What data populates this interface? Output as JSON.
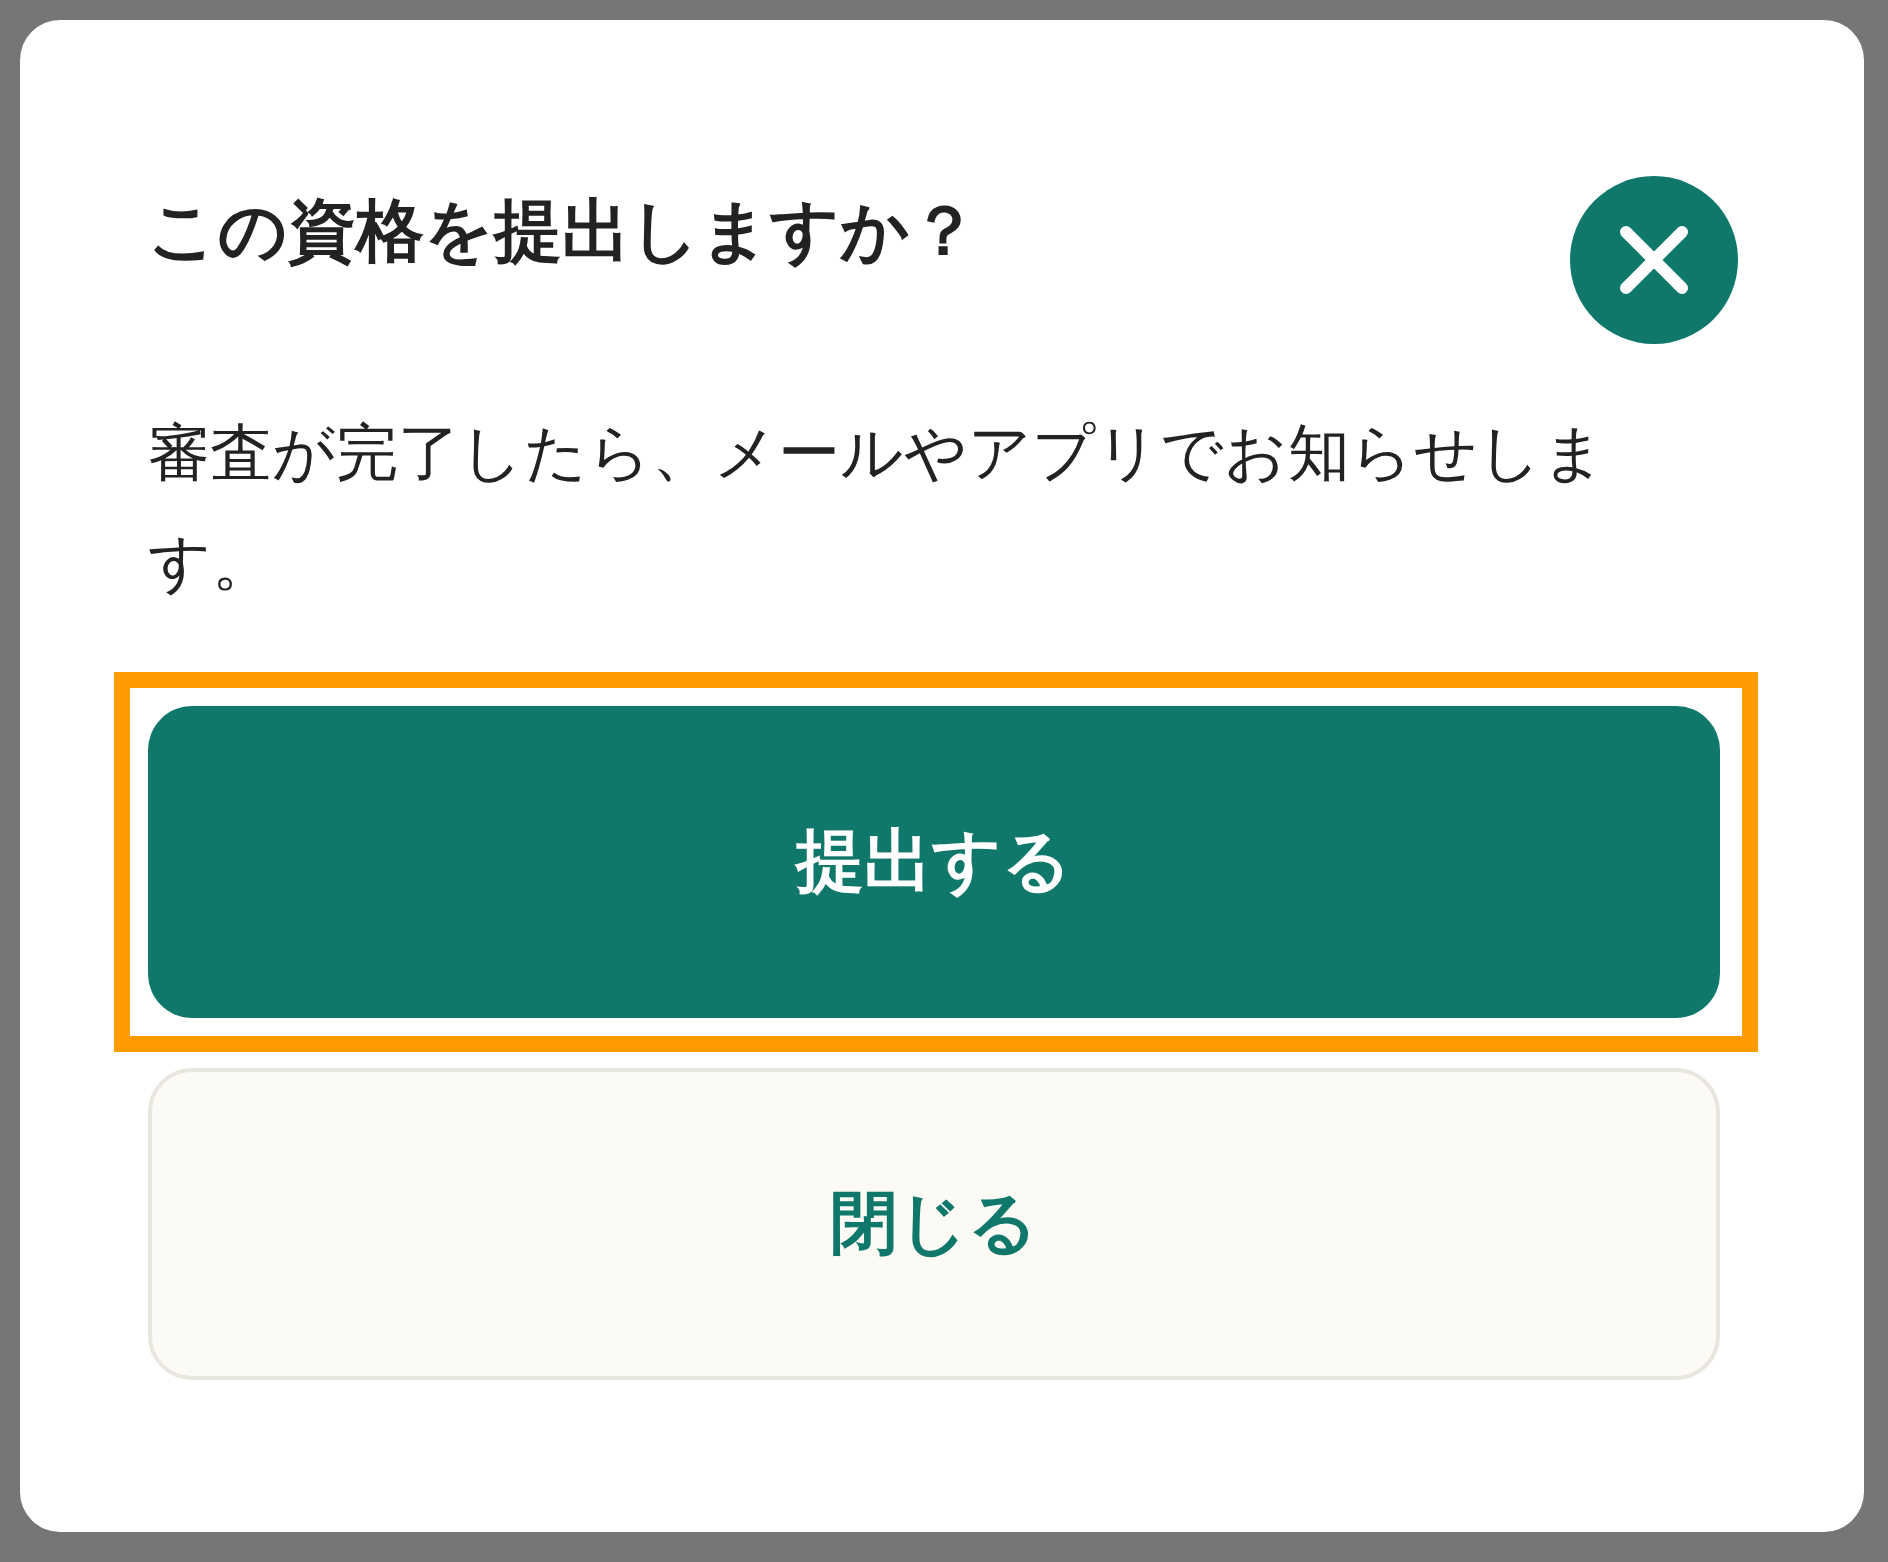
{
  "dialog": {
    "title": "この資格を提出しますか？",
    "message": "審査が完了したら、メールやアプリでお知らせします。"
  },
  "buttons": [
    {
      "label": "提出する",
      "kind": "primary",
      "highlighted": true
    },
    {
      "label": "閉じる",
      "kind": "secondary",
      "highlighted": false
    }
  ]
}
